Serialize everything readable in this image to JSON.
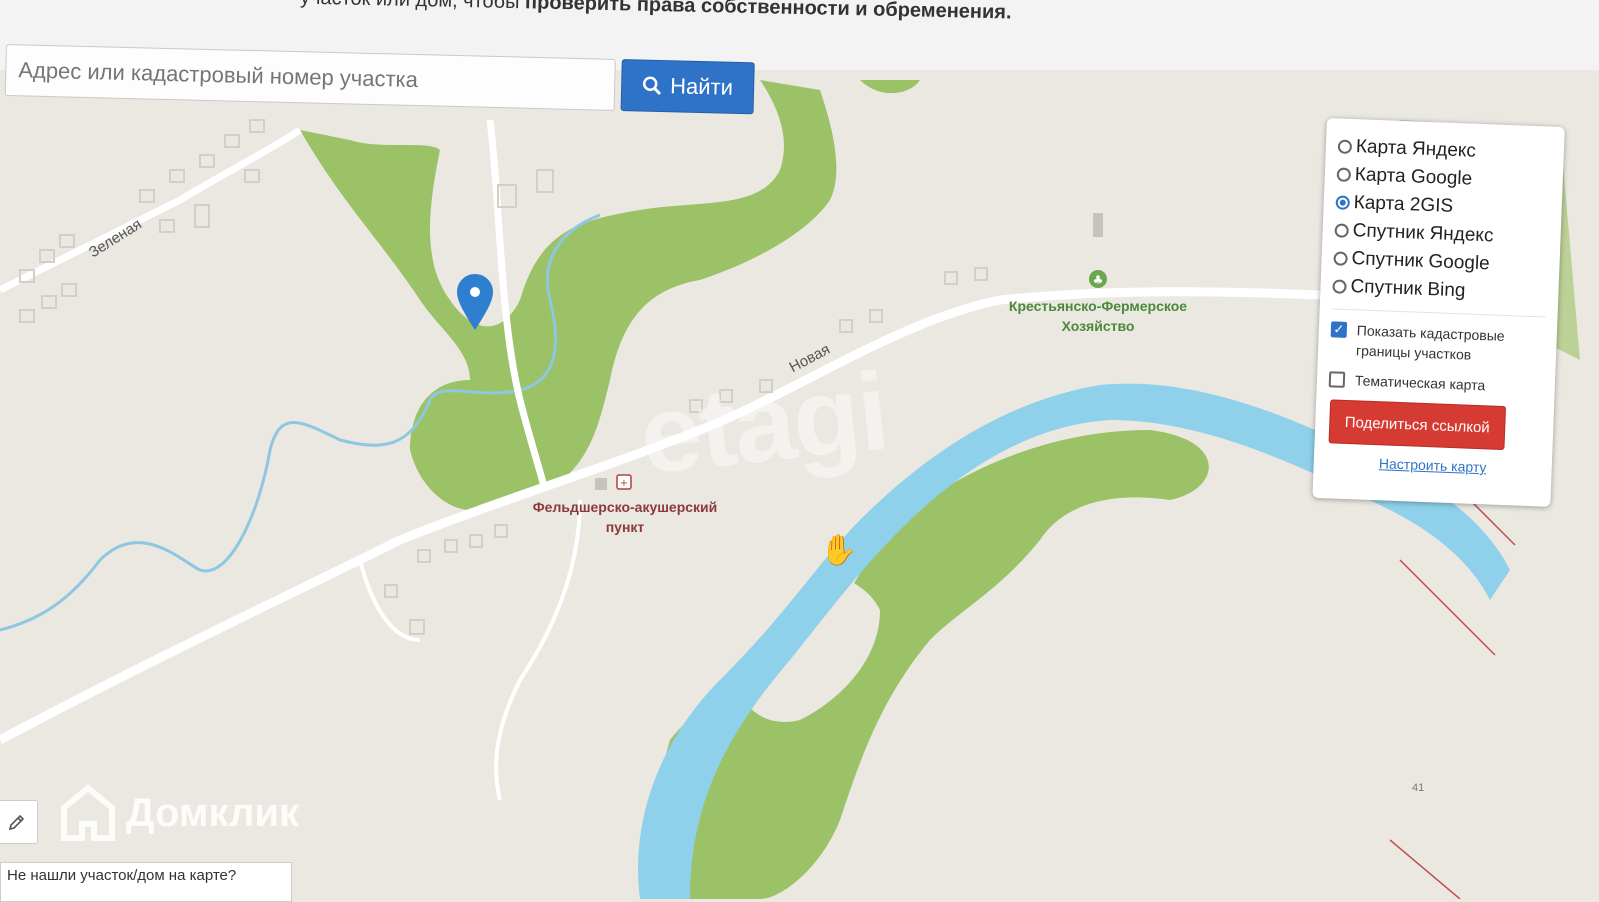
{
  "header": {
    "instruction_prefix": "участок или дом, чтобы ",
    "instruction_bold": "проверить права собственности и обременения."
  },
  "search": {
    "placeholder": "Адрес или кадастровый номер участка",
    "button_label": "Найти"
  },
  "map_layers": {
    "options": [
      {
        "label": "Карта Яндекс",
        "selected": false
      },
      {
        "label": "Карта Google",
        "selected": false
      },
      {
        "label": "Карта 2GIS",
        "selected": true
      },
      {
        "label": "Спутник Яндекс",
        "selected": false
      },
      {
        "label": "Спутник Google",
        "selected": false
      },
      {
        "label": "Спутник Bing",
        "selected": false
      }
    ],
    "cadastral_label": "Показать кадастровые границы участков",
    "cadastral_checked": true,
    "thematic_label": "Тематическая карта",
    "thematic_checked": false,
    "share_label": "Поделиться ссылкой",
    "settings_label": "Настроить карту"
  },
  "map": {
    "poi_farm": "Крестьянско-Фермерское Хозяйство",
    "poi_clinic": "Фельдшерско-акушерский пункт",
    "street_zelenaya": "Зеленая",
    "street_novaya": "Новая",
    "watermark": "etagi",
    "zoom_value": "41"
  },
  "footer": {
    "logo_text": "Домклик",
    "not_found_text": "Не нашли участок/дом на карте?"
  },
  "colors": {
    "river": "#8fd0ea",
    "forest": "#9cc268",
    "land": "#ebe8e2",
    "accent": "#2f73c9",
    "share": "#d63b33"
  }
}
